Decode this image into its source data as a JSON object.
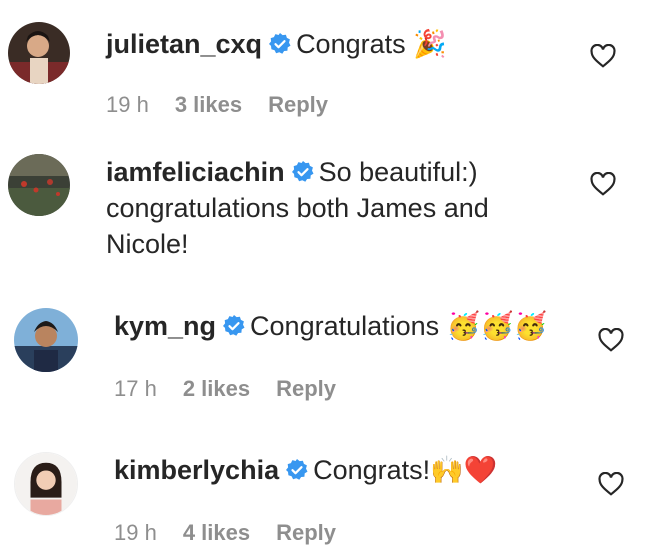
{
  "comments": [
    {
      "username": "julietan_cxq",
      "text": "Congrats",
      "emoji": "🎉",
      "time": "19 h",
      "likes": "3 likes",
      "reply": "Reply",
      "avatar_icon": "avatar-julietan-icon"
    },
    {
      "username": "iamfeliciachin",
      "text_line1": "So beautiful:)",
      "text_line2": "congratulations both James and",
      "text_line3": "Nicole!",
      "avatar_icon": "avatar-feliciachin-icon"
    },
    {
      "username": "kym_ng",
      "text": "Congratulations",
      "emoji": "🥳🥳🥳",
      "time": "17 h",
      "likes": "2 likes",
      "reply": "Reply",
      "avatar_icon": "avatar-kymng-icon"
    },
    {
      "username": "kimberlychia",
      "text": "Congrats!",
      "emoji": "🙌❤️",
      "time": "19 h",
      "likes": "4 likes",
      "reply": "Reply",
      "avatar_icon": "avatar-kimberlychia-icon"
    }
  ],
  "colors": {
    "text": "#262626",
    "meta": "#8e8e8e",
    "verified": "#3897f0"
  }
}
